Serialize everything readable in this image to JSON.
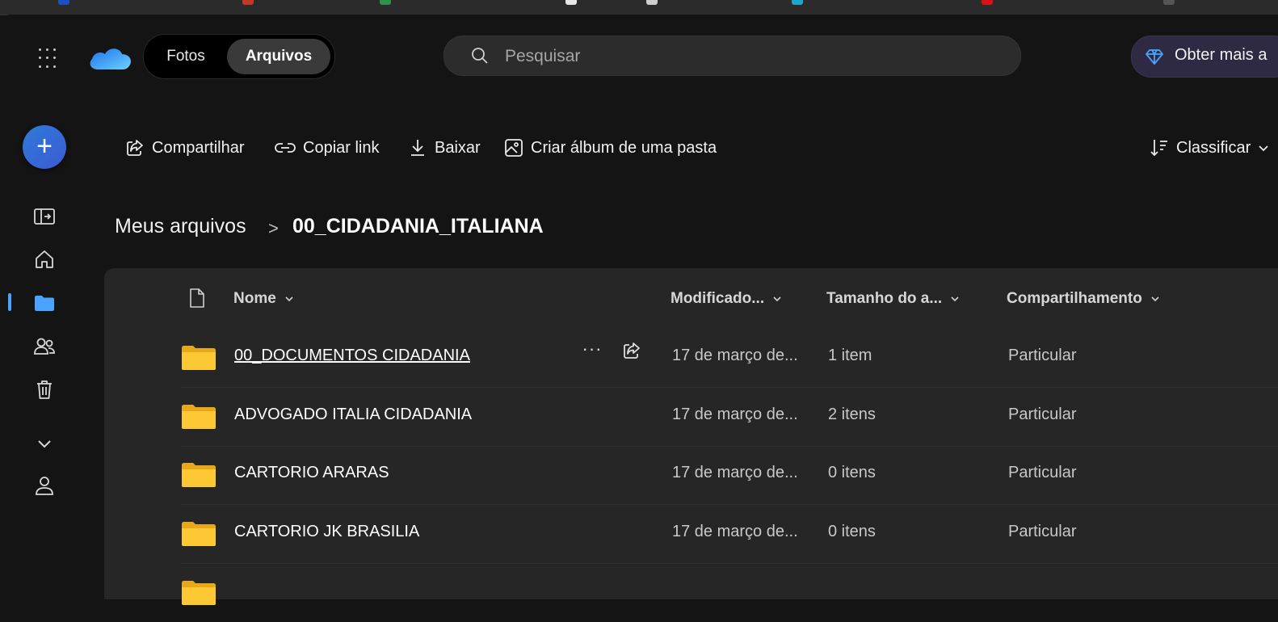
{
  "app": {
    "switcher": {
      "photos_label": "Fotos",
      "files_label": "Arquivos",
      "active": "Arquivos"
    },
    "search": {
      "placeholder": "Pesquisar",
      "value": ""
    },
    "premium_label": "Obter mais a"
  },
  "rail": {
    "new_icon": "plus-icon",
    "items": [
      {
        "name": "collapse-pane-icon",
        "active": false
      },
      {
        "name": "home-icon",
        "active": false
      },
      {
        "name": "folder-icon",
        "active": true
      },
      {
        "name": "shared-people-icon",
        "active": false
      },
      {
        "name": "recycle-bin-icon",
        "active": false
      },
      {
        "name": "chevron-down-icon",
        "active": false
      },
      {
        "name": "account-icon",
        "active": false
      }
    ]
  },
  "command_bar": {
    "share_label": "Compartilhar",
    "copy_link_label": "Copiar link",
    "download_label": "Baixar",
    "create_album_label": "Criar álbum de uma pasta",
    "sort_label": "Classificar"
  },
  "breadcrumb": {
    "root": "Meus arquivos",
    "separator": ">",
    "current": "00_CIDADANIA_ITALIANA"
  },
  "table": {
    "columns": {
      "name": "Nome",
      "modified": "Modificado...",
      "size": "Tamanho do a...",
      "sharing": "Compartilhamento"
    },
    "rows": [
      {
        "name": "00_DOCUMENTOS CIDADANIA",
        "modified": "17 de março de...",
        "size": "1 item",
        "sharing": "Particular",
        "hovered": true
      },
      {
        "name": "ADVOGADO ITALIA CIDADANIA",
        "modified": "17 de março de...",
        "size": "2 itens",
        "sharing": "Particular",
        "hovered": false
      },
      {
        "name": "CARTORIO ARARAS",
        "modified": "17 de março de...",
        "size": "0 itens",
        "sharing": "Particular",
        "hovered": false
      },
      {
        "name": "CARTORIO JK BRASILIA",
        "modified": "17 de março de...",
        "size": "0 itens",
        "sharing": "Particular",
        "hovered": false
      }
    ],
    "row_actions": {
      "more_label": "···"
    }
  },
  "colors": {
    "background": "#141414",
    "panel": "#262626",
    "accent": "#4aa3ff",
    "folder": "#f5c518"
  }
}
